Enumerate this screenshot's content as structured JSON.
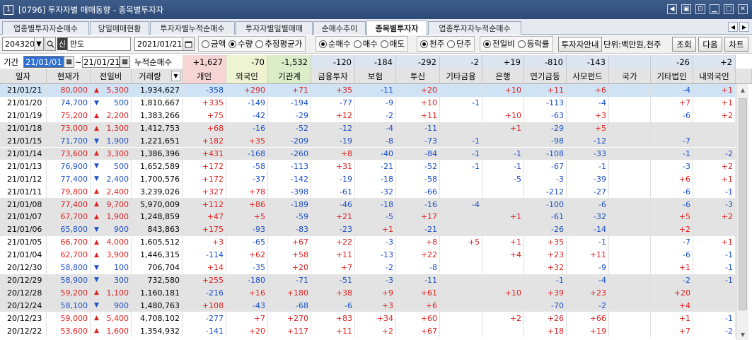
{
  "window": {
    "number": "1",
    "title": "[0796] 투자자별 매매동향 - 종목별투자자",
    "controls": [
      "◀",
      "▣",
      "⊡",
      "▁",
      "□",
      "✕"
    ]
  },
  "tabs": [
    "업종별투자자순매수",
    "당일매매현황",
    "투자자별누적순매수",
    "투자자별일별매매",
    "순매수추이",
    "종목별투자자",
    "업종투자자누적순매수"
  ],
  "controls": {
    "stock_code": "204320",
    "stock_flag": "신",
    "stock_name": "만도",
    "date": "2021/01/21",
    "amount_options": [
      "금액",
      "수량",
      "추정평균가"
    ],
    "trade_options": [
      "순매수",
      "매수",
      "매도"
    ],
    "unit_options": [
      "천주",
      "단주"
    ],
    "change_options": [
      "전일비",
      "등락률"
    ],
    "investor_info_button": "투자자안내",
    "unit_label": "단위:백만원,천주",
    "search_button": "조회",
    "next_button": "다음",
    "chart_button": "차트"
  },
  "period": {
    "label": "기간",
    "start": "21/01/01",
    "tilde": "~",
    "end": "21/01/21",
    "cum_label": "누적순매수"
  },
  "sums": [
    "+1,627",
    "-70",
    "-1,532",
    "-120",
    "-184",
    "-292",
    "-2",
    "+19",
    "-810",
    "-143",
    "",
    "-26",
    "+2"
  ],
  "columns": [
    "일자",
    "현재가",
    "전일비",
    "거래량",
    "개인",
    "외국인",
    "기관계",
    "금융투자",
    "보험",
    "투신",
    "기타금융",
    "은행",
    "연기금등",
    "사모펀드",
    "국가",
    "기타법인",
    "내외국인"
  ],
  "rows": [
    [
      "21/01/21",
      "80,000",
      "up",
      "5,300",
      "1,934,627",
      "-358",
      "+290",
      "+71",
      "+35",
      "-11",
      "+20",
      "",
      "+10",
      "+11",
      "+6",
      "",
      "-4",
      "+1"
    ],
    [
      "21/01/20",
      "74,700",
      "dn",
      "500",
      "1,810,667",
      "+335",
      "-149",
      "-194",
      "-77",
      "-9",
      "+10",
      "-1",
      "",
      "-113",
      "-4",
      "",
      "+7",
      "+1"
    ],
    [
      "21/01/19",
      "75,200",
      "up",
      "2,200",
      "1,383,266",
      "+75",
      "-42",
      "-29",
      "+12",
      "-2",
      "+11",
      "",
      "+10",
      "-63",
      "+3",
      "",
      "-6",
      "+2"
    ],
    [
      "21/01/18",
      "73,000",
      "up",
      "1,300",
      "1,412,753",
      "+68",
      "-16",
      "-52",
      "-12",
      "-4",
      "-11",
      "",
      "+1",
      "-29",
      "+5",
      "",
      "",
      ""
    ],
    [
      "21/01/15",
      "71,700",
      "dn",
      "1,900",
      "1,221,651",
      "+182",
      "+35",
      "-209",
      "-19",
      "-8",
      "-73",
      "-1",
      "",
      "-98",
      "-12",
      "",
      "-7",
      ""
    ],
    [
      "21/01/14",
      "73,600",
      "up",
      "3,300",
      "1,386,396",
      "+431",
      "-168",
      "-260",
      "+8",
      "-40",
      "-84",
      "-1",
      "-1",
      "-108",
      "-33",
      "",
      "-1",
      "-2"
    ],
    [
      "21/01/13",
      "76,900",
      "dn",
      "500",
      "1,652,589",
      "+172",
      "-58",
      "-113",
      "+31",
      "-21",
      "-52",
      "-1",
      "-1",
      "-67",
      "-1",
      "",
      "-3",
      "+2"
    ],
    [
      "21/01/12",
      "77,400",
      "dn",
      "2,400",
      "1,700,576",
      "+172",
      "-37",
      "-142",
      "-19",
      "-18",
      "-58",
      "",
      "-5",
      "-3",
      "-39",
      "",
      "+6",
      "+1"
    ],
    [
      "21/01/11",
      "79,800",
      "up",
      "2,400",
      "3,239,026",
      "+327",
      "+78",
      "-398",
      "-61",
      "-32",
      "-66",
      "",
      "",
      "-212",
      "-27",
      "",
      "-6",
      "-1"
    ],
    [
      "21/01/08",
      "77,400",
      "up",
      "9,700",
      "5,970,009",
      "+112",
      "+86",
      "-189",
      "-46",
      "-18",
      "-16",
      "-4",
      "",
      "-100",
      "-6",
      "",
      "-6",
      "-3"
    ],
    [
      "21/01/07",
      "67,700",
      "up",
      "1,900",
      "1,248,859",
      "+47",
      "+5",
      "-59",
      "+21",
      "-5",
      "+17",
      "",
      "+1",
      "-61",
      "-32",
      "",
      "+5",
      "+2"
    ],
    [
      "21/01/06",
      "65,800",
      "dn",
      "900",
      "843,863",
      "+175",
      "-93",
      "-83",
      "-23",
      "+1",
      "-21",
      "",
      "",
      "-26",
      "-14",
      "",
      "+2",
      ""
    ],
    [
      "21/01/05",
      "66,700",
      "up",
      "4,000",
      "1,605,512",
      "+3",
      "-65",
      "+67",
      "+22",
      "-3",
      "+8",
      "+5",
      "+1",
      "+35",
      "-1",
      "",
      "-7",
      "+1"
    ],
    [
      "21/01/04",
      "62,700",
      "up",
      "3,900",
      "1,446,315",
      "-114",
      "+62",
      "+58",
      "+11",
      "-13",
      "+22",
      "",
      "+4",
      "+23",
      "+11",
      "",
      "-6",
      "-1"
    ],
    [
      "20/12/30",
      "58,800",
      "dn",
      "100",
      "706,704",
      "+14",
      "-35",
      "+20",
      "+7",
      "-2",
      "-8",
      "",
      "",
      "+32",
      "-9",
      "",
      "+1",
      "-1"
    ],
    [
      "20/12/29",
      "58,900",
      "dn",
      "300",
      "732,580",
      "+255",
      "-180",
      "-71",
      "-51",
      "-3",
      "-11",
      "",
      "",
      "-1",
      "-4",
      "",
      "-2",
      "-1"
    ],
    [
      "20/12/28",
      "59,200",
      "up",
      "1,100",
      "1,160,181",
      "-216",
      "+16",
      "+180",
      "+38",
      "+9",
      "+61",
      "",
      "+10",
      "+39",
      "+23",
      "",
      "+20",
      ""
    ],
    [
      "20/12/24",
      "58,100",
      "dn",
      "900",
      "1,480,763",
      "+108",
      "-43",
      "-68",
      "-6",
      "+3",
      "+6",
      "",
      "",
      "-70",
      "-2",
      "",
      "+4",
      ""
    ],
    [
      "20/12/23",
      "59,000",
      "up",
      "5,400",
      "4,708,102",
      "-277",
      "+7",
      "+270",
      "+83",
      "+34",
      "+60",
      "",
      "+2",
      "+26",
      "+66",
      "",
      "+1",
      "-1"
    ],
    [
      "20/12/22",
      "53,600",
      "up",
      "1,600",
      "1,354,932",
      "-141",
      "+20",
      "+117",
      "+11",
      "+2",
      "+67",
      "",
      "",
      "+18",
      "+19",
      "",
      "+7",
      "-2"
    ]
  ],
  "colors": {
    "titlebar": "#34507e",
    "up": "#e0201f",
    "down": "#1b4fc4",
    "selected_row": "#cfe3f4",
    "gray_row": "#e3e3e3",
    "sum_row": "#dde5f1",
    "personal_header": "#f8d5d5",
    "foreign_header": "#eef3d2",
    "institution_header": "#dbecc8"
  }
}
